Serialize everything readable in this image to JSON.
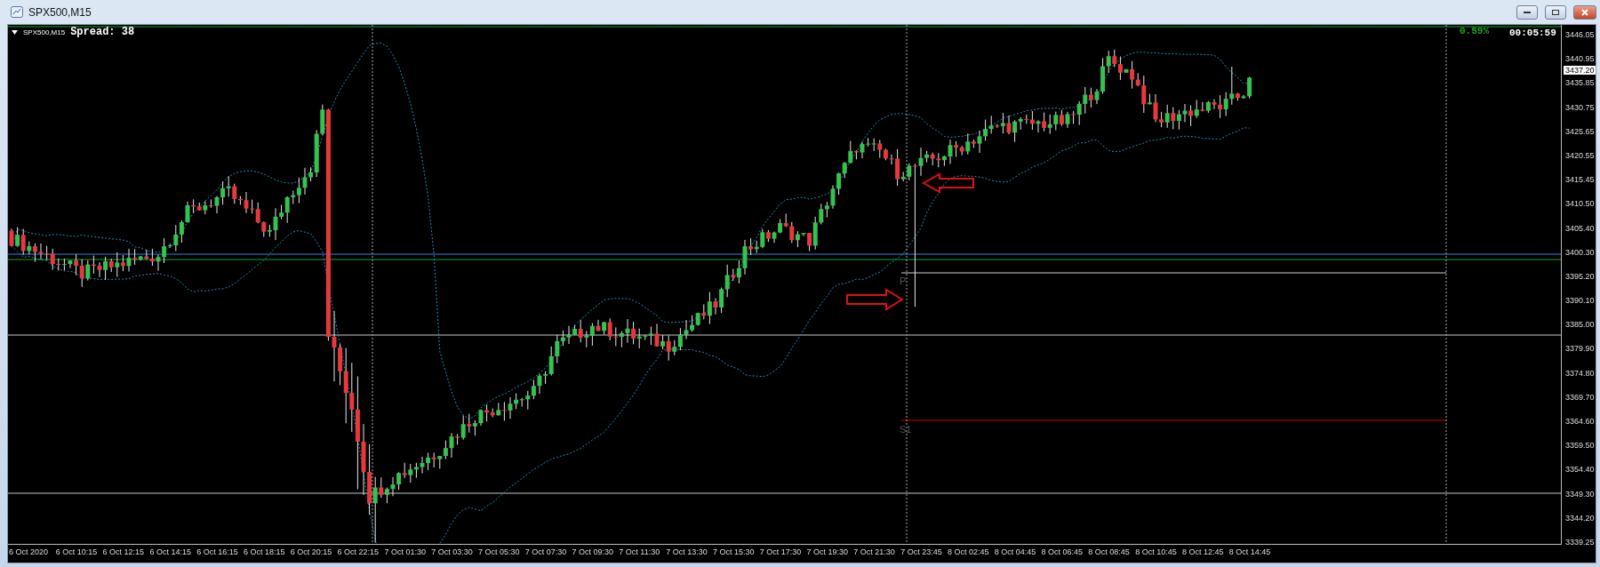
{
  "window": {
    "title": "SPX500,M15"
  },
  "chart": {
    "symbol": "SPX500,M15",
    "spread": "Spread: 38",
    "change": "0.59%",
    "countdown": "00:05:59",
    "price_tag": "3437.20",
    "pivot_labels": [
      "P",
      "S1"
    ],
    "price_axis": [
      "3446.05",
      "3440.95",
      "3435.85",
      "3430.75",
      "3425.65",
      "3420.55",
      "3415.45",
      "3410.50",
      "3405.40",
      "3400.30",
      "3395.20",
      "3390.10",
      "3385.00",
      "3379.90",
      "3374.80",
      "3369.70",
      "3364.60",
      "3359.50",
      "3354.40",
      "3349.30",
      "3344.20",
      "3339.25"
    ],
    "time_axis": [
      "6 Oct 2020",
      "6 Oct 10:15",
      "6 Oct 12:15",
      "6 Oct 14:15",
      "6 Oct 16:15",
      "6 Oct 18:15",
      "6 Oct 20:15",
      "6 Oct 22:15",
      "7 Oct 01:30",
      "7 Oct 03:30",
      "7 Oct 05:30",
      "7 Oct 07:30",
      "7 Oct 09:30",
      "7 Oct 11:30",
      "7 Oct 13:30",
      "7 Oct 15:30",
      "7 Oct 17:30",
      "7 Oct 19:30",
      "7 Oct 21:30",
      "7 Oct 23:45",
      "8 Oct 02:45",
      "8 Oct 04:45",
      "8 Oct 06:45",
      "8 Oct 08:45",
      "8 Oct 10:45",
      "8 Oct 12:45",
      "8 Oct 14:45"
    ]
  }
}
